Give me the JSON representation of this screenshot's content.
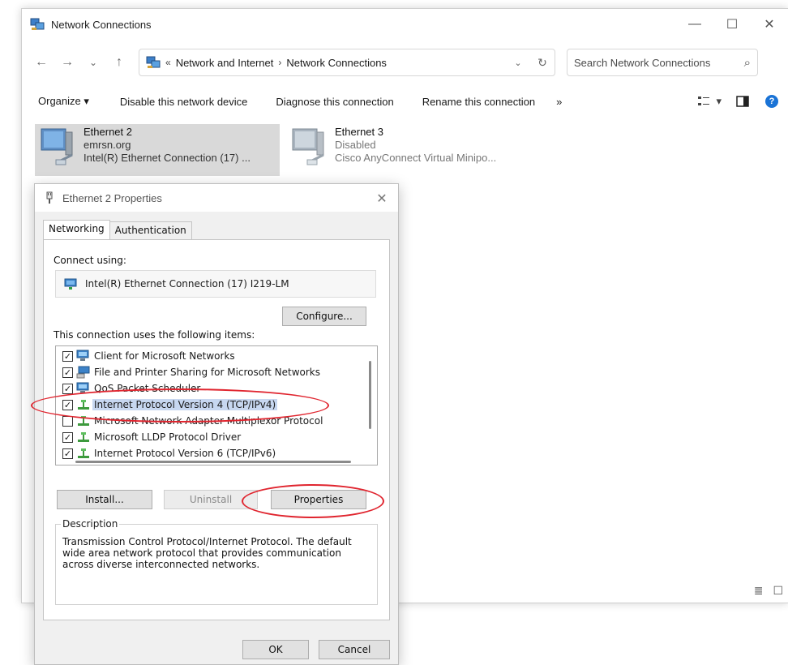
{
  "window": {
    "title": "Network Connections",
    "controls": {
      "minimize": "—",
      "maximize": "☐",
      "close": "✕"
    }
  },
  "nav": {
    "back": "←",
    "forward": "→",
    "recent": "⌄",
    "up": "↑",
    "breadcrumb_prefix": "«",
    "crumbs": [
      "Network and Internet",
      "Network Connections"
    ],
    "crumb_sep": "›",
    "dropdown": "⌄",
    "refresh": "↻",
    "search_placeholder": "Search Network Connections",
    "search_icon": "⌕"
  },
  "commands": {
    "organize": "Organize ▾",
    "disable": "Disable this network device",
    "diagnose": "Diagnose this connection",
    "rename": "Rename this connection",
    "more": "»",
    "view": "▾",
    "help": "?"
  },
  "connections": [
    {
      "name": "Ethernet 2",
      "line1": "emrsn.org",
      "line2": "Intel(R) Ethernet Connection (17) ..."
    },
    {
      "name": "Ethernet 3",
      "line1": "Disabled",
      "line2": "Cisco AnyConnect Virtual Minipo..."
    }
  ],
  "view_buttons": {
    "details": "≣",
    "tiles": "☐"
  },
  "dialog": {
    "title": "Ethernet 2 Properties",
    "close": "✕",
    "tabs": [
      "Networking",
      "Authentication"
    ],
    "connect_using_label": "Connect using:",
    "adapter": "Intel(R) Ethernet Connection (17) I219-LM",
    "configure": "Configure...",
    "items_label": "This connection uses the following items:",
    "items": [
      {
        "label": "Client for Microsoft Networks",
        "checked": true,
        "icon": "client-icon"
      },
      {
        "label": "File and Printer Sharing for Microsoft Networks",
        "checked": true,
        "icon": "sharing-icon"
      },
      {
        "label": "QoS Packet Scheduler",
        "checked": true,
        "icon": "qos-icon"
      },
      {
        "label": "Internet Protocol Version 4 (TCP/IPv4)",
        "checked": true,
        "icon": "protocol-icon",
        "selected": true
      },
      {
        "label": "Microsoft Network Adapter Multiplexor Protocol",
        "checked": false,
        "icon": "protocol-icon"
      },
      {
        "label": "Microsoft LLDP Protocol Driver",
        "checked": true,
        "icon": "protocol-icon"
      },
      {
        "label": "Internet Protocol Version 6 (TCP/IPv6)",
        "checked": true,
        "icon": "protocol-icon"
      }
    ],
    "check_mark": "✓",
    "install": "Install...",
    "uninstall": "Uninstall",
    "properties": "Properties",
    "description_legend": "Description",
    "description": "Transmission Control Protocol/Internet Protocol. The default wide area network protocol that provides communication across diverse interconnected networks.",
    "ok": "OK",
    "cancel": "Cancel"
  },
  "colors": {
    "selection": "#c7d7f0",
    "annotation": "#e0252f",
    "selected_item_bg": "#d9d9d9"
  }
}
